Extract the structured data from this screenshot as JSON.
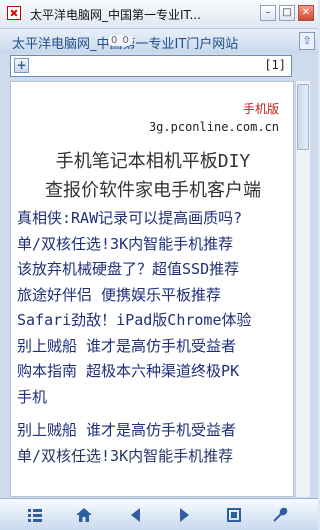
{
  "window": {
    "title": "太平洋电脑网_中国第一专业IT...",
    "tab_title": "太平洋电脑网_中国第一专业IT门户网站",
    "loading_indicator": "0 0"
  },
  "addressbar": {
    "page_count": "[1]"
  },
  "page": {
    "brand": "手机版",
    "domain": "3g.pconline.com.cn",
    "nav_row_1": "手机笔记本相机平板DIY",
    "nav_row_2": "查报价软件家电手机客户端",
    "lines": [
      "真相侠:RAW记录可以提高画质吗?",
      "单/双核任选!3K内智能手机推荐",
      "该放弃机械硬盘了？超值SSD推荐",
      "旅途好伴侣 便携娱乐平板推荐",
      "Safari劲敌！iPad版Chrome体验",
      "别上贼船 谁才是高仿手机受益者",
      "购本指南 超极本六种渠道终极PK",
      "手机",
      "别上贼船 谁才是高仿手机受益者",
      "单/双核任选!3K内智能手机推荐"
    ]
  },
  "toolbar": {
    "icons": [
      "menu-icon",
      "home-icon",
      "back-icon",
      "forward-icon",
      "window-icon",
      "tools-icon"
    ]
  }
}
